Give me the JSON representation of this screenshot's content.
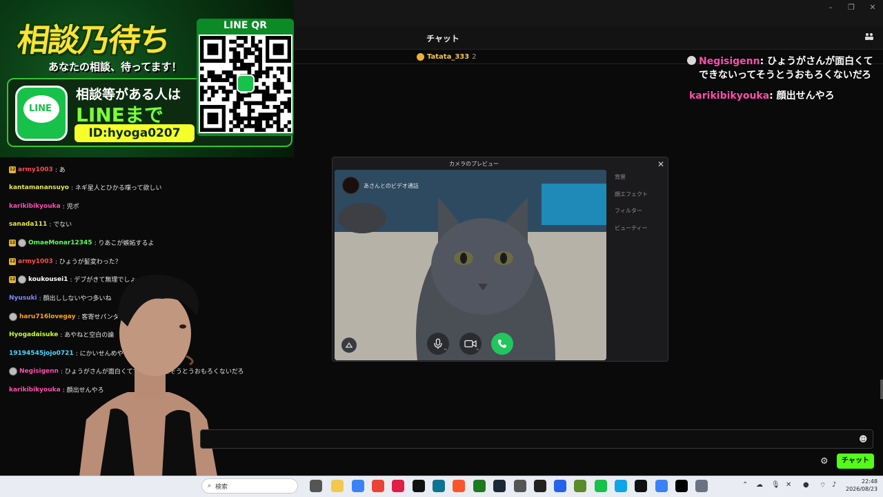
{
  "chat": {
    "title": "チャット",
    "gifter": {
      "name": "Tatata_333",
      "count": "2"
    },
    "messages": [
      {
        "user": "army1003",
        "text": ": あ",
        "color": "#ff4d4d",
        "badge": "12",
        "avatar": false
      },
      {
        "user": "kantamanansuyo",
        "text": ": ネギ星人とひかる喋って欲しい",
        "color": "#e6e64a",
        "badge": "",
        "avatar": false
      },
      {
        "user": "karikibikyouka",
        "text": ": 児ポ",
        "color": "#ff4fb0",
        "badge": "",
        "avatar": false
      },
      {
        "user": "sanada111",
        "text": ": でない",
        "color": "#e6e64a",
        "badge": "",
        "avatar": false
      },
      {
        "user": "OmaeMonar12345",
        "text": ": りあこが嫉妬するよ",
        "color": "#5cff5c",
        "badge": "12",
        "avatar": true
      },
      {
        "user": "army1003",
        "text": ": ひょうが髪変わった？",
        "color": "#ff4d4d",
        "badge": "12",
        "avatar": false
      },
      {
        "user": "koukousei1",
        "text": ": デブがきて無理でしょ",
        "color": "#ffffff",
        "badge": "12",
        "avatar": true
      },
      {
        "user": "Nyusuki",
        "text": ": 顔出ししないやつ多いね",
        "color": "#7a8cff",
        "badge": "",
        "avatar": false
      },
      {
        "user": "haru716lovegay",
        "text": ": 客寄せパンダ",
        "color": "#ffa31a",
        "badge": "",
        "avatar": true
      },
      {
        "user": "Hyogadaisuke",
        "text": ": あやねと空白の論",
        "color": "#c8ff2e",
        "badge": "",
        "avatar": false
      },
      {
        "user": "19194545jojo0721",
        "text": ": にかいせんめや",
        "color": "#4ad9ff",
        "badge": "",
        "avatar": false
      },
      {
        "user": "Negisigenn",
        "text": ": ひょうがさんが面白くてできないってそうとうおもろくないだろ",
        "color": "#ff4fb0",
        "badge": "",
        "avatar": true
      },
      {
        "user": "karikibikyouka",
        "text": ": 顔出せんやろ",
        "color": "#ff4fb0",
        "badge": "",
        "avatar": false
      }
    ],
    "send_label": "チャット"
  },
  "overlay": [
    {
      "user": "Negisigenn",
      "text": ": ひょうがさんが面白くてできないってそうとうおもろくないだろ",
      "avatar": true
    },
    {
      "user": "karikibikyouka",
      "text": ": 顔出せんやろ",
      "avatar": false
    }
  ],
  "promo": {
    "title": "相談乃待ち",
    "subtitle": "あなたの相談、待ってます！",
    "line_logo": "LINE",
    "line1": "相談等がある人は",
    "line2": "LINEまで",
    "line_id": "ID:hyoga0207",
    "qr_label": "LINE QR"
  },
  "camera_dialog": {
    "title": "カメラのプレビュー",
    "call_label": "あさんとのビデオ通話",
    "options": [
      "背景",
      "顔エフェクト",
      "フィルター",
      "ビューティー"
    ]
  },
  "taskbar": {
    "search_placeholder": "検索",
    "time": "22:48",
    "date": "2026/08/23"
  },
  "colors": {
    "accent": "#53fc18",
    "line_green": "#17c14a"
  }
}
